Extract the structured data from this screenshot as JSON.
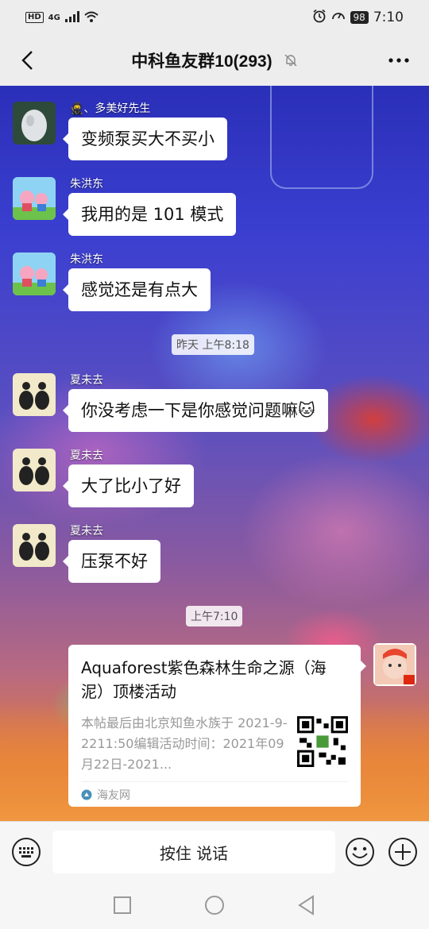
{
  "status_bar": {
    "hd": "HD",
    "network": "4G",
    "battery": "98",
    "time": "7:10"
  },
  "nav": {
    "title": "中科鱼友群10(293)"
  },
  "messages": [
    {
      "sender": "🥷、多美好先生",
      "text": "变频泵买大不买小"
    },
    {
      "sender": "朱洪东",
      "text": "我用的是 101 模式"
    },
    {
      "sender": "朱洪东",
      "text": "感觉还是有点大"
    },
    {
      "sender": "夏未去",
      "text": "你没考虑一下是你感觉问题嘛🐱"
    },
    {
      "sender": "夏未去",
      "text": "大了比小了好"
    },
    {
      "sender": "夏未去",
      "text": "压泵不好"
    }
  ],
  "timestamps": {
    "t1": "昨天 上午8:18",
    "t2": "上午7:10"
  },
  "link_card": {
    "title": "Aquaforest紫色森林生命之源（海泥）顶楼活动",
    "description": "本帖最后由北京知鱼水族于 2021-9-2211:50编辑活动时间：2021年09月22日-2021...",
    "source": "海友网"
  },
  "input_bar": {
    "hold_to_talk": "按住 说话"
  },
  "colors": {
    "bubble": "#ffffff",
    "nav_bg": "#ededed",
    "wallpaper_top": "#2a2fb8",
    "wallpaper_bottom": "#f08a30"
  }
}
